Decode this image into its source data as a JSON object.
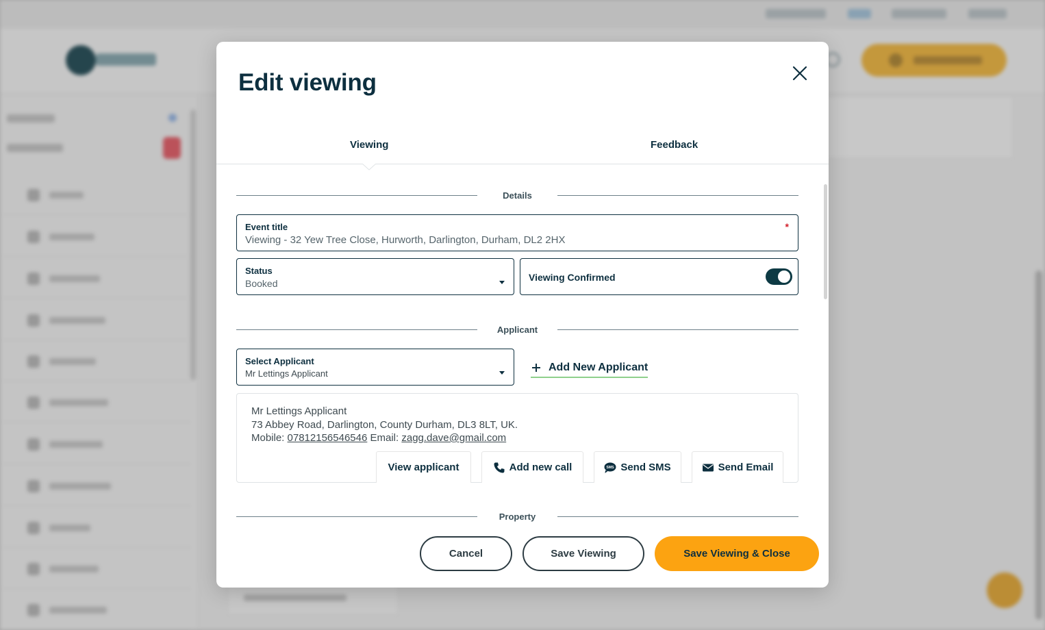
{
  "modal": {
    "title": "Edit viewing",
    "close_icon": "close-icon"
  },
  "tabs": [
    {
      "label": "Viewing",
      "active": true
    },
    {
      "label": "Feedback",
      "active": false
    }
  ],
  "sections": {
    "details": "Details",
    "applicant": "Applicant",
    "property": "Property"
  },
  "event_title": {
    "label": "Event title",
    "required_mark": "*",
    "value": "Viewing - 32 Yew Tree Close, Hurworth, Darlington, Durham, DL2 2HX"
  },
  "status": {
    "label": "Status",
    "value": "Booked"
  },
  "viewing_confirmed": {
    "label": "Viewing Confirmed",
    "checked": true
  },
  "select_applicant": {
    "label": "Select Applicant",
    "value": "Mr Lettings Applicant"
  },
  "add_new_applicant": {
    "label": "Add New Applicant",
    "icon": "plus-icon"
  },
  "applicant_card": {
    "name": "Mr Lettings Applicant",
    "address": "73 Abbey Road, Darlington, County Durham, DL3 8LT, UK.",
    "mobile_label": "Mobile:",
    "mobile": "07812156546546",
    "email_label": "Email:",
    "email": "zagg.dave@gmail.com",
    "buttons": {
      "view": "View applicant",
      "call": "Add new call",
      "sms": "Send SMS",
      "email": "Send Email"
    }
  },
  "footer": {
    "cancel": "Cancel",
    "save": "Save Viewing",
    "save_close": "Save Viewing & Close"
  },
  "colors": {
    "primary_dark": "#0d2f3f",
    "accent_orange": "#fca311",
    "toggle_on": "#0d3a44",
    "required_red": "#d21f2b",
    "underline_green": "#8fd08c"
  }
}
